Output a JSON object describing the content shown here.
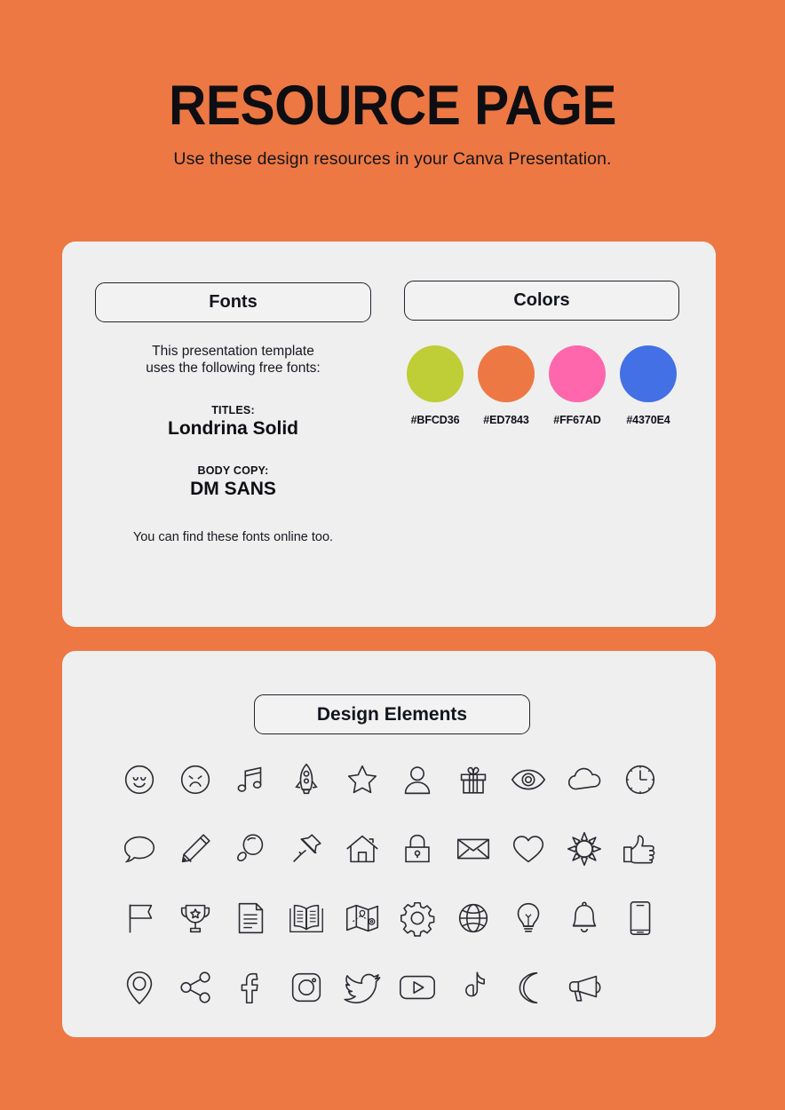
{
  "header": {
    "title": "RESOURCE PAGE",
    "subtitle": "Use these design resources in your Canva Presentation."
  },
  "theme": {
    "background": "#ED7843",
    "card_background": "#EFEFEF",
    "text": "#14141A"
  },
  "resources_card": {
    "fonts": {
      "pill_label": "Fonts",
      "intro": "This presentation template\nuses the following free fonts:",
      "entries": [
        {
          "kicker": "TITLES:",
          "name": "Londrina Solid"
        },
        {
          "kicker": "BODY COPY:",
          "name": "DM SANS"
        }
      ],
      "note": "You can find these fonts online too."
    },
    "colors": {
      "pill_label": "Colors",
      "swatches": [
        {
          "hex": "#BFCD36",
          "label": "#BFCD36"
        },
        {
          "hex": "#ED7843",
          "label": "#ED7843"
        },
        {
          "hex": "#FF67AD",
          "label": "#FF67AD"
        },
        {
          "hex": "#4370E4",
          "label": "#4370E4"
        }
      ]
    }
  },
  "elements_card": {
    "pill_label": "Design Elements",
    "icons": [
      "smiley-face-icon",
      "sad-face-icon",
      "music-note-icon",
      "rocket-icon",
      "star-icon",
      "person-icon",
      "gift-icon",
      "eye-icon",
      "cloud-icon",
      "clock-icon",
      "speech-bubble-icon",
      "pencil-icon",
      "magnifier-icon",
      "pushpin-icon",
      "house-icon",
      "lock-icon",
      "envelope-icon",
      "heart-icon",
      "sun-icon",
      "thumbs-up-icon",
      "flag-icon",
      "trophy-icon",
      "document-icon",
      "book-icon",
      "map-icon",
      "gear-icon",
      "globe-icon",
      "lightbulb-icon",
      "bell-icon",
      "phone-icon",
      "location-pin-icon",
      "share-icon",
      "facebook-icon",
      "instagram-icon",
      "twitter-icon",
      "youtube-icon",
      "tiktok-icon",
      "moon-icon",
      "megaphone-icon"
    ]
  }
}
